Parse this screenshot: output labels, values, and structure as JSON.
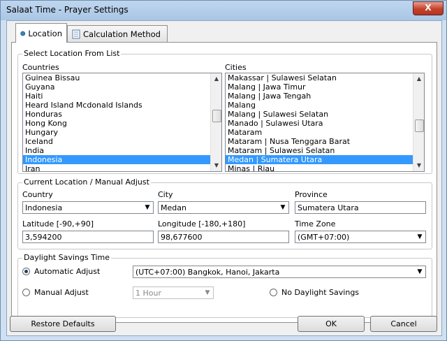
{
  "window": {
    "title": "Salaat Time - Prayer Settings",
    "close_glyph": "X"
  },
  "tabs": [
    {
      "label": "Location",
      "icon": "globe-icon"
    },
    {
      "label": "Calculation Method",
      "icon": "notepad-icon"
    }
  ],
  "select_location": {
    "legend": "Select Location From List",
    "countries_label": "Countries",
    "countries": [
      "Guinea Bissau",
      "Guyana",
      "Haiti",
      "Heard Island Mcdonald Islands",
      "Honduras",
      "Hong Kong",
      "Hungary",
      "Iceland",
      "India",
      "Indonesia",
      "Iran"
    ],
    "countries_selected": "Indonesia",
    "cities_label": "Cities",
    "cities": [
      "Makassar | Sulawesi Selatan",
      "Malang | Jawa Timur",
      "Malang | Jawa Tengah",
      "Malang",
      "Malang | Sulawesi Selatan",
      "Manado | Sulawesi Utara",
      "Mataram",
      "Mataram | Nusa Tenggara Barat",
      "Mataram | Sulawesi Selatan",
      "Medan | Sumatera Utara",
      "Minas | Riau"
    ],
    "cities_selected": "Medan | Sumatera Utara"
  },
  "current_location": {
    "legend": "Current Location / Manual Adjust",
    "country_label": "Country",
    "country_value": "Indonesia",
    "city_label": "City",
    "city_value": "Medan",
    "province_label": "Province",
    "province_value": "Sumatera Utara",
    "latitude_label": "Latitude [-90,+90]",
    "latitude_value": "3,594200",
    "longitude_label": "Longitude [-180,+180]",
    "longitude_value": "98,677600",
    "timezone_label": "Time Zone",
    "timezone_value": "(GMT+07:00)"
  },
  "daylight": {
    "legend": "Daylight Savings Time",
    "automatic_label": "Automatic Adjust",
    "automatic_checked": true,
    "automatic_zone": "(UTC+07:00) Bangkok, Hanoi, Jakarta",
    "manual_label": "Manual Adjust",
    "manual_value": "1 Hour",
    "none_label": "No Daylight Savings"
  },
  "buttons": {
    "restore": "Restore Defaults",
    "ok": "OK",
    "cancel": "Cancel"
  },
  "colors": {
    "selection": "#3399ff",
    "titlebar": "#a9c6e6",
    "close": "#c4402a"
  }
}
